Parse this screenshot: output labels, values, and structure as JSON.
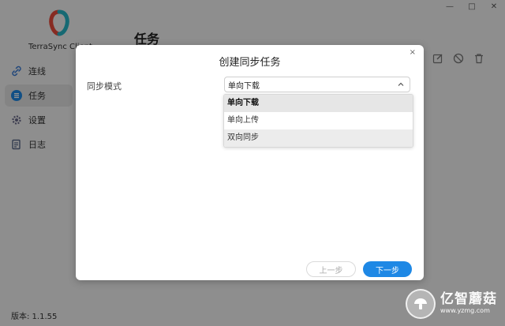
{
  "window": {
    "controls": [
      "—",
      "□",
      "✕"
    ]
  },
  "sidebar": {
    "app_name": "TerraSync Client",
    "items": [
      {
        "label": "连线",
        "icon": "link-icon"
      },
      {
        "label": "任务",
        "icon": "tasks-icon",
        "active": true
      },
      {
        "label": "设置",
        "icon": "gear-icon"
      },
      {
        "label": "日志",
        "icon": "log-icon"
      }
    ],
    "version": "版本: 1.1.55"
  },
  "main": {
    "title": "任务",
    "toolbar": [
      "edit-icon",
      "disable-icon",
      "trash-icon"
    ]
  },
  "dialog": {
    "title": "创建同步任务",
    "close": "×",
    "field_label": "同步模式",
    "select": {
      "value": "单向下载",
      "options": [
        "单向下载",
        "单向上传",
        "双向同步"
      ],
      "selected_index": 0,
      "highlighted_index": 2
    },
    "prev_label": "上一步",
    "next_label": "下一步"
  },
  "watermark": {
    "name": "亿智蘑菇",
    "url": "www.yzmg.com"
  },
  "colors": {
    "accent": "#1e88e5",
    "logo_red": "#e84a3c",
    "logo_teal": "#26b5c7"
  }
}
